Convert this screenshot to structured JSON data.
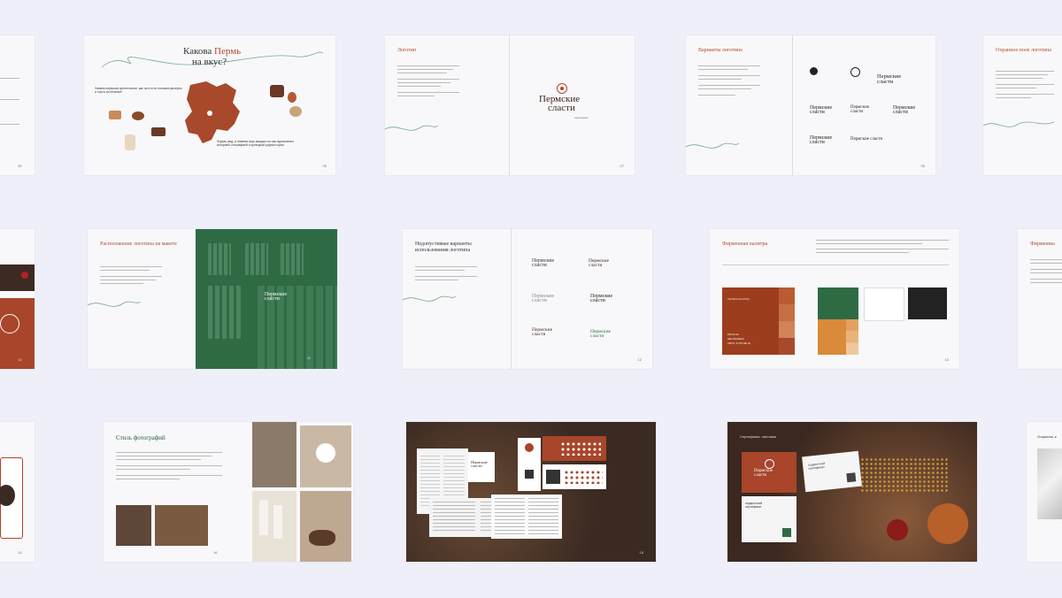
{
  "slides": {
    "taste": {
      "title_1": "Какова",
      "title_accent": "Пермь",
      "title_2": "на вкус?",
      "subtitle": "Узнаем пермское аутентичное, как на что не похожее десерты и торты из печеньё!",
      "footer": "Форма, вид, и главное вкус каждого из нас вдохновлен историей, географией и культурой родного края",
      "page": "06"
    },
    "logo": {
      "title": "Логотип",
      "page": "07",
      "logo_line1": "Пермские",
      "logo_line2": "сласти",
      "logo_tag": "кондитерская"
    },
    "variants": {
      "title": "Варианты логотипа",
      "page": "08",
      "logo_line1": "Пермские",
      "logo_line2": "сласти"
    },
    "protect": {
      "title": "Охранное поле логотипа"
    },
    "placement": {
      "title": "Расположение логотипа на макете",
      "page": "11",
      "logo_line1": "Пермские",
      "logo_line2": "сласти"
    },
    "invalid": {
      "title": "Недопустимые варианты использования логотипа",
      "page": "12",
      "logo_line1": "Пермские",
      "logo_line2": "сласти"
    },
    "palette": {
      "title": "Фирменная палитра",
      "label_main": "ПЕРМСКОЕ МОРЕ",
      "main_hex": "#9C3E1D",
      "main_rgb": "156 62 29",
      "main_cmyk": "CMYK: 27 83 100 22",
      "hex_label": "HEX",
      "page": "13"
    },
    "brand_right": {
      "title": "Фирменны"
    },
    "photo_style": {
      "title": "Стиль фотографий",
      "page": "16"
    },
    "menu": {
      "title": "Меню, вывески",
      "page": "18",
      "logo_line1": "Пермские",
      "logo_line2": "сласти"
    },
    "certs": {
      "title": "Сертификат, листовки",
      "cert_label_1": "подарочный сертификат",
      "cert_label_2": "подарочный сертификат",
      "logo_line1": "Пермские",
      "logo_line2": "сласти"
    },
    "postcards": {
      "title": "Открытка, к"
    },
    "left1": {
      "page": "05"
    },
    "left3": {
      "page": "15"
    },
    "left2": {
      "page": "10"
    }
  },
  "colors": {
    "background": "#eeeff9",
    "rust": "#b3472b",
    "rust_dark": "#9c3e1d",
    "green": "#2e6b45",
    "green_dark": "#245a3a",
    "orange": "#d98a3a"
  }
}
